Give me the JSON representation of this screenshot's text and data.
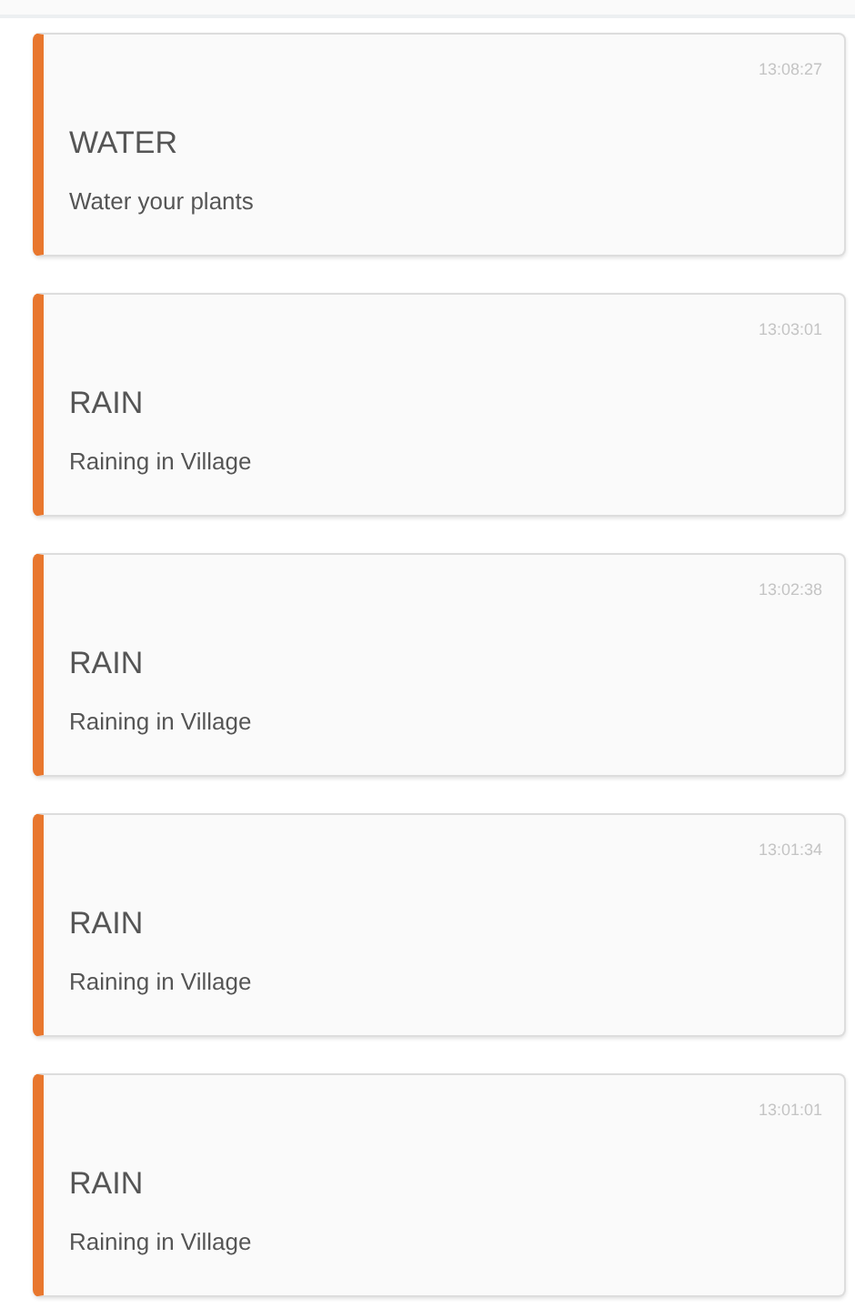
{
  "notifications": [
    {
      "time": "13:08:27",
      "title": "WATER",
      "message": "Water your plants"
    },
    {
      "time": "13:03:01",
      "title": "RAIN",
      "message": "Raining in Village"
    },
    {
      "time": "13:02:38",
      "title": "RAIN",
      "message": "Raining in Village"
    },
    {
      "time": "13:01:34",
      "title": "RAIN",
      "message": "Raining in Village"
    },
    {
      "time": "13:01:01",
      "title": "RAIN",
      "message": "Raining in Village"
    }
  ]
}
